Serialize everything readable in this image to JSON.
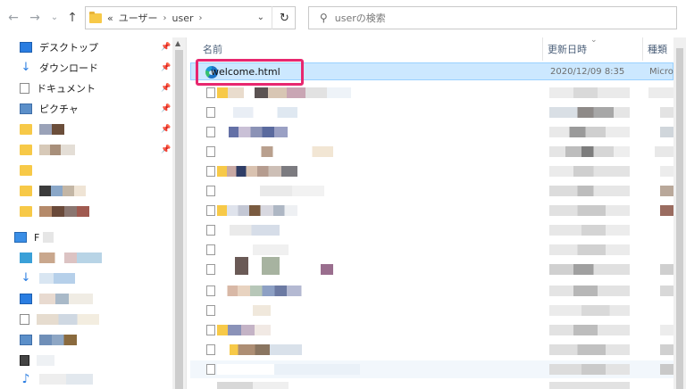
{
  "toolbar": {
    "back": "←",
    "forward": "→",
    "recent": "⌄",
    "up": "↑",
    "breadcrumb_overflow": "«",
    "breadcrumb": [
      "ユーザー",
      "user"
    ],
    "separator": "›",
    "dropdown": "⌄",
    "refresh": "↻",
    "search_placeholder": "userの検索"
  },
  "nav": {
    "items": [
      {
        "label": "デスクトップ",
        "icon": "desktop-icon",
        "pinned": true
      },
      {
        "label": "ダウンロード",
        "icon": "download-icon",
        "pinned": true
      },
      {
        "label": "ドキュメント",
        "icon": "document-icon",
        "pinned": true
      },
      {
        "label": "ピクチャ",
        "icon": "pictures-icon",
        "pinned": true
      }
    ],
    "pc_label": "F",
    "pin_glyph": "📌"
  },
  "columns": {
    "name": "名前",
    "date": "更新日時",
    "type": "種類"
  },
  "files": [
    {
      "name": "welcome.html",
      "date": "2020/12/09 8:35",
      "type": "Micro",
      "selected": true
    }
  ],
  "colors": {
    "selection": "#cce8ff",
    "highlight_border": "#e8276f"
  }
}
